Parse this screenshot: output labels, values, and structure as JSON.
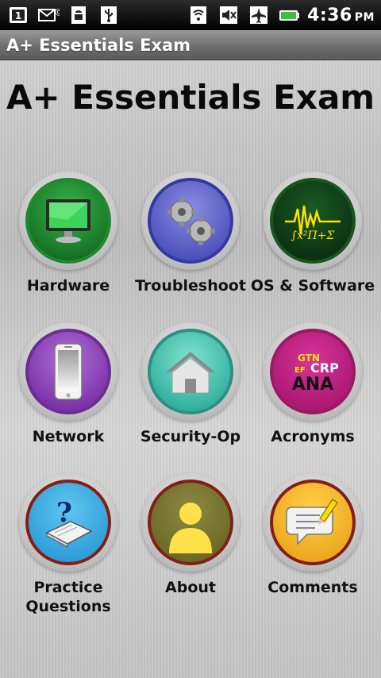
{
  "status_bar": {
    "time": "4:36",
    "ampm": "PM",
    "left_icons": [
      "sim-one-icon",
      "missed-email-icon",
      "android-debug-icon",
      "usb-icon"
    ],
    "right_icons": [
      "wifi-icon",
      "mute-icon",
      "airplane-mode-icon",
      "battery-icon"
    ]
  },
  "title_bar": {
    "title": "A+ Essentials Exam"
  },
  "main": {
    "heading": "A+ Essentials Exam",
    "tiles": [
      {
        "label": "Hardware",
        "icon": "monitor-icon",
        "color": "#1b8a2a"
      },
      {
        "label": "Troubleshoot",
        "icon": "gears-icon",
        "color": "#3a3fb0"
      },
      {
        "label": "OS & Software",
        "icon": "waveform-icon",
        "color": "#0f5a1f"
      },
      {
        "label": "Network",
        "icon": "smartphone-icon",
        "color": "#7a2aa8"
      },
      {
        "label": "Security-Op",
        "icon": "house-icon",
        "color": "#1aa090"
      },
      {
        "label": "Acronyms",
        "icon": "acronyms-icon",
        "color": "#b8157a",
        "text": [
          "GTN",
          "EF",
          "CRP",
          "ANA"
        ]
      },
      {
        "label": "Practice Questions",
        "label_lines": [
          "Practice",
          "Questions"
        ],
        "icon": "question-book-icon",
        "color": "#1f8fd0"
      },
      {
        "label": "About",
        "icon": "person-icon",
        "color": "#c8a817"
      },
      {
        "label": "Comments",
        "icon": "speech-bubble-icon",
        "color": "#e59a10"
      }
    ]
  }
}
